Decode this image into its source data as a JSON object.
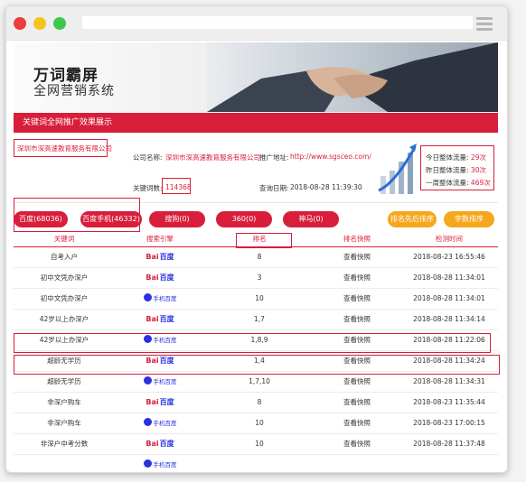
{
  "banner": {
    "title": "万词霸屏",
    "subtitle": "全网营销系统"
  },
  "section_title": "关键词全网推广效果展示",
  "company_box": "深圳市深高速教育服务有限公司",
  "info": {
    "company_label": "公司名称:",
    "company_value": "深圳市深高速教育服务有限公司",
    "url_label": "推广地址:",
    "url_value": "http://www.sgsceo.com/",
    "kw_label": "关键词数:",
    "kw_value": "114368",
    "date_label": "查询日期:",
    "date_value": "2018-08-28 11:39:30"
  },
  "traffic": {
    "today": "今日整体流量: ",
    "today_v": "29次",
    "yesterday": "昨日整体流量: ",
    "yesterday_v": "30次",
    "week": "一周整体流量: ",
    "week_v": "469次"
  },
  "tabs": [
    "百度(68036)",
    "百度手机(46332)",
    "搜狗(0)",
    "360(0)",
    "神马(0)",
    "排名先后排序",
    "字数排序"
  ],
  "columns": [
    "关键词",
    "搜索引擎",
    "排名",
    "排名快照",
    "检测时间"
  ],
  "engine_names": {
    "baidu_a": "Bai",
    "baidu_b": "百度",
    "mobile": "手机百度"
  },
  "rows": [
    {
      "kw": "自考入户",
      "engine": "baidu",
      "rank": "8",
      "snap": "查看快照",
      "time": "2018-08-23 16:55:46"
    },
    {
      "kw": "初中文凭办深户",
      "engine": "baidu",
      "rank": "3",
      "snap": "查看快照",
      "time": "2018-08-28 11:34:01"
    },
    {
      "kw": "初中文凭办深户",
      "engine": "mobile",
      "rank": "10",
      "snap": "查看快照",
      "time": "2018-08-28 11:34:01"
    },
    {
      "kw": "42岁以上办深户",
      "engine": "baidu",
      "rank": "1,7",
      "snap": "查看快照",
      "time": "2018-08-28 11:34:14"
    },
    {
      "kw": "42岁以上办深户",
      "engine": "mobile",
      "rank": "1,8,9",
      "snap": "查看快照",
      "time": "2018-08-28 11:22:06"
    },
    {
      "kw": "超龄无学历",
      "engine": "baidu",
      "rank": "1,4",
      "snap": "查看快照",
      "time": "2018-08-28 11:34:24"
    },
    {
      "kw": "超龄无学历",
      "engine": "mobile",
      "rank": "1,7,10",
      "snap": "查看快照",
      "time": "2018-08-28 11:34:31"
    },
    {
      "kw": "非深户购车",
      "engine": "baidu",
      "rank": "8",
      "snap": "查看快照",
      "time": "2018-08-23 11:35:44"
    },
    {
      "kw": "非深户购车",
      "engine": "mobile",
      "rank": "10",
      "snap": "查看快照",
      "time": "2018-08-23 17:00:15"
    },
    {
      "kw": "非深户中考分数",
      "engine": "baidu",
      "rank": "10",
      "snap": "查看快照",
      "time": "2018-08-28 11:37:48"
    },
    {
      "kw": "",
      "engine": "mobile",
      "rank": "",
      "snap": "",
      "time": ""
    }
  ],
  "colors": {
    "accent": "#d81e3a",
    "orange": "#f5a71d",
    "baidu_blue": "#2932e1"
  }
}
